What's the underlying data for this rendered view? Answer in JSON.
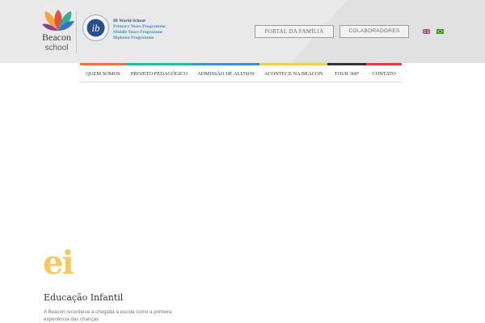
{
  "header": {
    "logo": {
      "name": "Beacon",
      "sub": "school"
    },
    "ib": {
      "lines": [
        "IB World School",
        "Primary Years Programme",
        "Middle Years Programme",
        "Diploma Programme"
      ]
    },
    "buttons": {
      "portal": "PORTAL DA FAMÍLIA",
      "colaboradores": "COLABORADORES"
    },
    "flags": {
      "en": "uk-flag-icon",
      "pt": "brazil-flag-icon"
    }
  },
  "nav": {
    "items": [
      {
        "label": "QUEM SOMOS",
        "color": "#e57543"
      },
      {
        "label": "PROJETO PEDAGÓGICO",
        "color": "#2db6a0"
      },
      {
        "label": "ADMISSÃO DE ALUNOS",
        "color": "#3f8fd1"
      },
      {
        "label": "ACONTECE NA BEACON",
        "color": "#f3c95c"
      },
      {
        "label": "TOUR 360º",
        "color": "#333333"
      },
      {
        "label": "CONTATO",
        "color": "#d9463f"
      }
    ]
  },
  "hero": {
    "badge": "ei",
    "title": "Educação Infantil",
    "text": "A Beacon reconhece a chegada à escola como a primeira experiência das chanças"
  },
  "colors": {
    "accent_yellow": "#f5c95f",
    "header_bg": "#e9e9e9"
  }
}
